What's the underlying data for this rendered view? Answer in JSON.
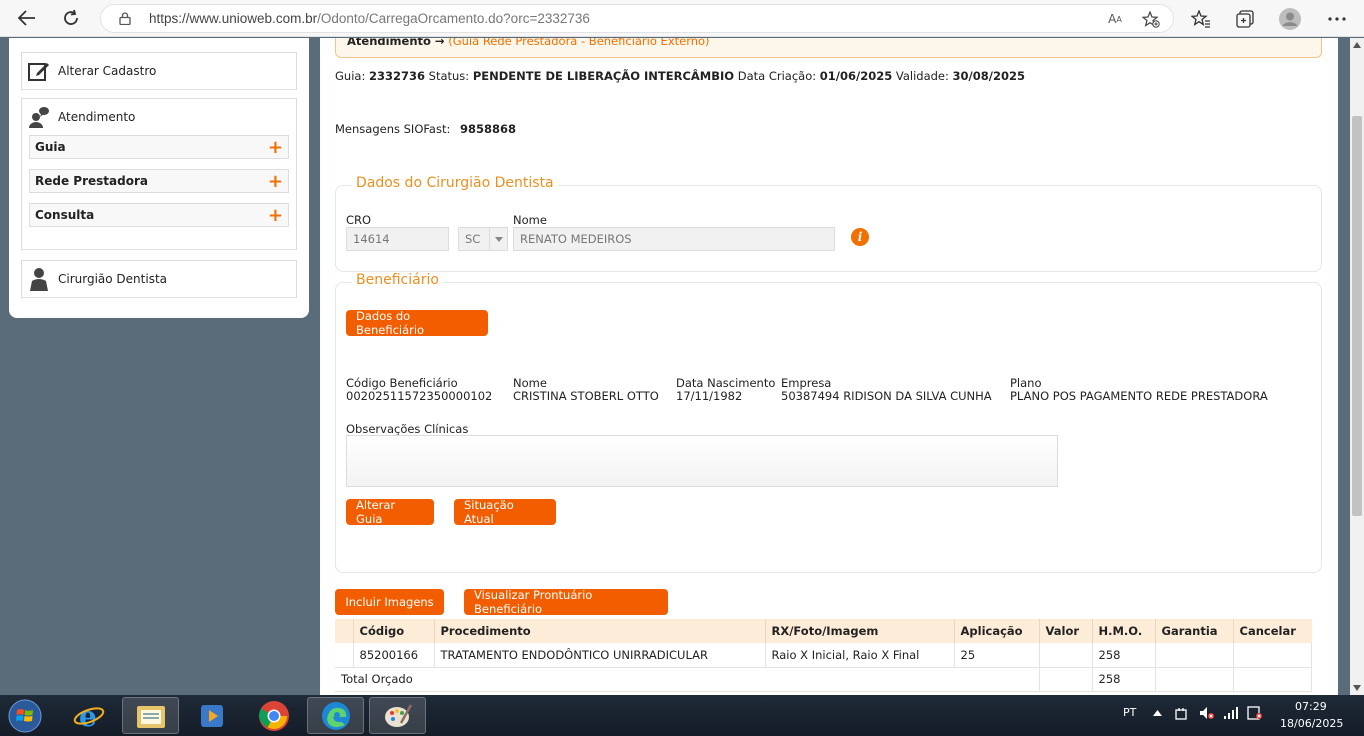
{
  "browser": {
    "url_host": "https://www.unioweb.com.br",
    "url_path": "/Odonto/CarregaOrcamento.do?orc=2332736"
  },
  "sidebar": {
    "alterar_cadastro": "Alterar Cadastro",
    "atendimento": "Atendimento",
    "items": [
      {
        "label": "Guia"
      },
      {
        "label": "Rede Prestadora"
      },
      {
        "label": "Consulta"
      }
    ],
    "cirurgiao": "Cirurgião Dentista"
  },
  "header": {
    "atendimento_label": "Atendimento →",
    "atendimento_detail": "(Guia Rede Prestadora - Beneficiário Externo)"
  },
  "guia": {
    "guia_label": "Guia:",
    "guia_value": "2332736",
    "status_label": "Status:",
    "status_value": "PENDENTE DE LIBERAÇÃO INTERCÂMBIO",
    "criacao_label": "Data Criação:",
    "criacao_value": "01/06/2025",
    "validade_label": "Validade:",
    "validade_value": "30/08/2025",
    "msg_label": "Mensagens SIOFast:",
    "msg_value": "9858868"
  },
  "dentista": {
    "legend": "Dados do Cirurgião Dentista",
    "cro_label": "CRO",
    "cro_value": "14614",
    "uf_value": "SC",
    "nome_label": "Nome",
    "nome_value": "RENATO MEDEIROS"
  },
  "beneficiario": {
    "legend": "Beneficiário",
    "dados_button": "Dados do Beneficiário",
    "codigo_label": "Código Beneficiário",
    "codigo_value": "00202511572350000102",
    "nome_label": "Nome",
    "nome_value": "CRISTINA STOBERL OTTO",
    "nascimento_label": "Data Nascimento",
    "nascimento_value": "17/11/1982",
    "empresa_label": "Empresa",
    "empresa_value": "50387494 RIDISON DA SILVA CUNHA",
    "plano_label": "Plano",
    "plano_value": "PLANO POS PAGAMENTO REDE PRESTADORA",
    "obs_label": "Observações Clínicas",
    "obs_value": "",
    "alterar_button": "Alterar Guia",
    "situacao_button": "Situação Atual"
  },
  "actions": {
    "incluir_imagens": "Incluir Imagens",
    "visualizar_prontuario": "Visualizar Prontuário Beneficiário"
  },
  "table": {
    "headers": [
      "Código",
      "Procedimento",
      "RX/Foto/Imagem",
      "Aplicação",
      "Valor",
      "H.M.O.",
      "Garantia",
      "Cancelar"
    ],
    "rows": [
      {
        "codigo": "85200166",
        "procedimento": "TRATAMENTO ENDODÔNTICO UNIRRADICULAR",
        "rx": "Raio X Inicial, Raio X Final",
        "aplicacao": "25",
        "valor": "",
        "hmo": "258",
        "garantia": "",
        "cancelar": ""
      }
    ],
    "total_label": "Total Orçado",
    "total_hmo": "258"
  },
  "taskbar": {
    "lang": "PT",
    "time": "07:29",
    "date": "18/06/2025"
  }
}
